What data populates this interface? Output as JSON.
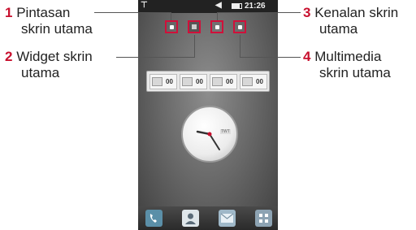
{
  "callouts": [
    {
      "num": "1",
      "line1": "Pintasan",
      "line2": "skrin utama"
    },
    {
      "num": "2",
      "line1": "Widget skrin",
      "line2": "utama"
    },
    {
      "num": "3",
      "line1": "Kenalan skrin",
      "line2": "utama"
    },
    {
      "num": "4",
      "line1": "Multimedia",
      "line2": "skrin utama"
    }
  ],
  "phone": {
    "status_time": "21:26",
    "widget_counts": [
      "00",
      "00",
      "00",
      "00"
    ],
    "clock_brand": "TWT"
  },
  "colors": {
    "accent": "#c8102e",
    "highlight": "#d0103a"
  },
  "icons": [
    "signal-icon",
    "speaker-icon",
    "battery-icon",
    "phone-icon",
    "contacts-icon",
    "message-icon",
    "menu-icon"
  ]
}
